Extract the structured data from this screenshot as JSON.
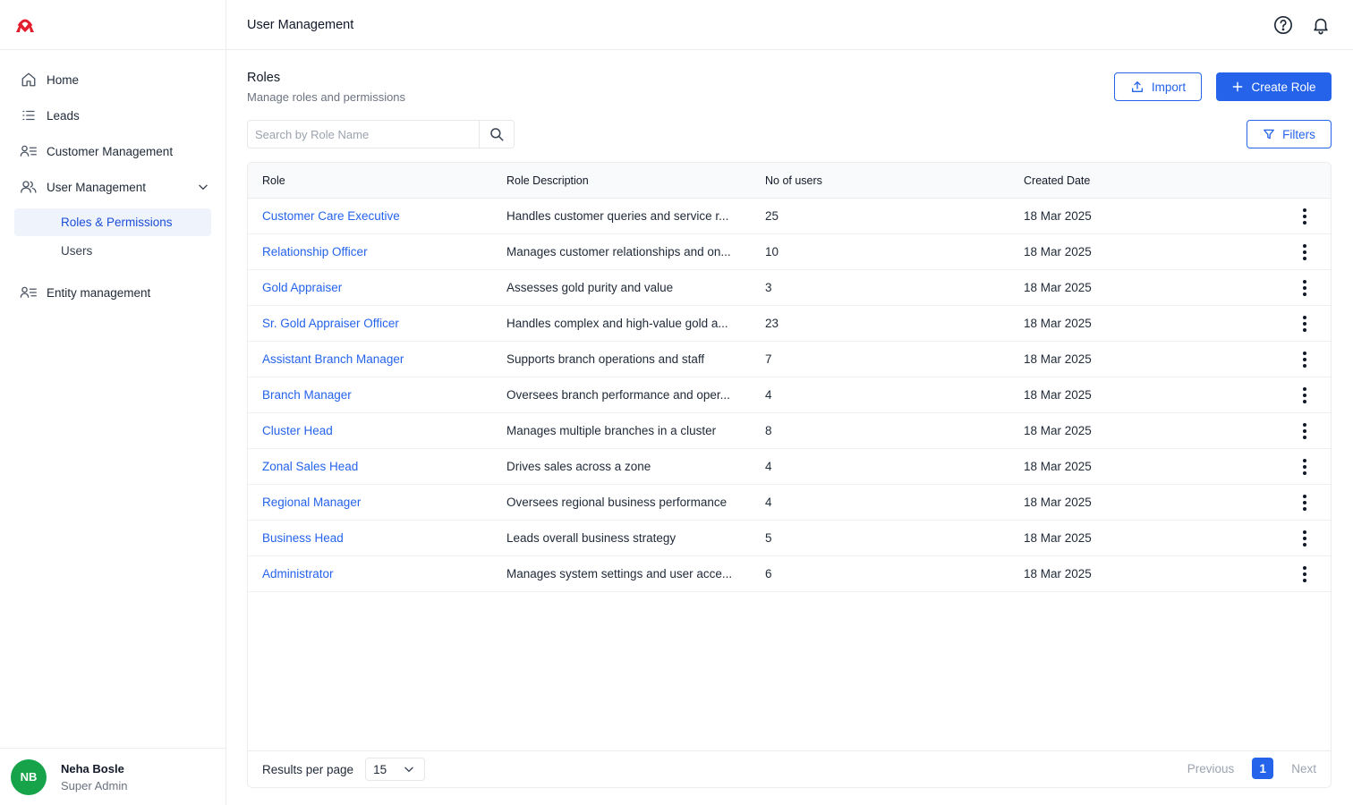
{
  "brand": {
    "logo": "brand-logo",
    "accent": "#e11d2e"
  },
  "header": {
    "title": "User Management"
  },
  "sidebar": {
    "items": [
      {
        "label": "Home",
        "icon": "home-icon"
      },
      {
        "label": "Leads",
        "icon": "list-icon"
      },
      {
        "label": "Customer Management",
        "icon": "user-list-icon"
      },
      {
        "label": "User Management",
        "icon": "users-icon",
        "expanded": true,
        "children": [
          {
            "label": "Roles & Permissions",
            "active": true
          },
          {
            "label": "Users",
            "active": false
          }
        ]
      },
      {
        "label": "Entity management",
        "icon": "user-list-icon"
      }
    ]
  },
  "user": {
    "initials": "NB",
    "name": "Neha Bosle",
    "role": "Super Admin",
    "avatar_color": "#16a34a"
  },
  "page": {
    "title": "Roles",
    "subtitle": "Manage roles and permissions",
    "import_label": "Import",
    "create_label": "Create Role",
    "filters_label": "Filters",
    "search_placeholder": "Search by Role Name"
  },
  "table": {
    "columns": [
      "Role",
      "Role Description",
      "No of users",
      "Created Date"
    ],
    "rows": [
      {
        "role": "Customer Care Executive",
        "description": "Handles customer queries and service r...",
        "users": "25",
        "created": "18 Mar 2025"
      },
      {
        "role": "Relationship Officer",
        "description": "Manages customer relationships and on...",
        "users": "10",
        "created": "18 Mar 2025"
      },
      {
        "role": "Gold Appraiser",
        "description": "Assesses gold purity and value",
        "users": "3",
        "created": "18 Mar 2025"
      },
      {
        "role": "Sr. Gold Appraiser Officer",
        "description": "Handles complex and high-value gold a...",
        "users": "23",
        "created": "18 Mar 2025"
      },
      {
        "role": "Assistant Branch Manager",
        "description": "Supports branch operations and staff",
        "users": "7",
        "created": "18 Mar 2025"
      },
      {
        "role": "Branch Manager",
        "description": "Oversees branch performance and oper...",
        "users": "4",
        "created": "18 Mar 2025"
      },
      {
        "role": "Cluster Head",
        "description": "Manages multiple branches in a cluster",
        "users": "8",
        "created": "18 Mar 2025"
      },
      {
        "role": "Zonal Sales Head",
        "description": "Drives sales across a zone",
        "users": "4",
        "created": "18 Mar 2025"
      },
      {
        "role": "Regional Manager",
        "description": "Oversees regional business performance",
        "users": "4",
        "created": "18 Mar 2025"
      },
      {
        "role": "Business Head",
        "description": "Leads overall business strategy",
        "users": "5",
        "created": "18 Mar 2025"
      },
      {
        "role": "Administrator",
        "description": "Manages system settings and user acce...",
        "users": "6",
        "created": "18 Mar 2025"
      }
    ]
  },
  "pagination": {
    "results_label": "Results per page",
    "per_page": "15",
    "previous": "Previous",
    "current": "1",
    "next": "Next"
  }
}
